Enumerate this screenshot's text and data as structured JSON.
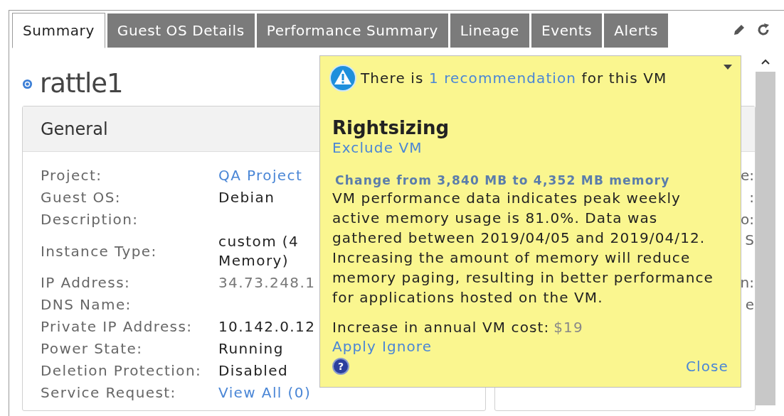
{
  "tabs": [
    {
      "label": "Summary",
      "selected": true
    },
    {
      "label": "Guest OS Details",
      "selected": false
    },
    {
      "label": "Performance Summary",
      "selected": false
    },
    {
      "label": "Lineage",
      "selected": false
    },
    {
      "label": "Events",
      "selected": false
    },
    {
      "label": "Alerts",
      "selected": false
    }
  ],
  "vm_name": "rattle1",
  "general": {
    "title": "General",
    "rows": [
      {
        "label": "Project:",
        "value": "QA Project",
        "kind": "link"
      },
      {
        "label": "Guest OS:",
        "value": "Debian",
        "kind": "text"
      },
      {
        "label": "Description:",
        "kind": "empty"
      },
      {
        "label": "Instance Type:",
        "value": "custom (4",
        "value_line_2": "Memory)",
        "kind": "text"
      },
      {
        "label": "IP Address:",
        "value": "34.73.248.1",
        "kind": "muted"
      },
      {
        "label": "DNS Name:",
        "kind": "empty"
      },
      {
        "label": "Private IP Address:",
        "value": "10.142.0.12",
        "kind": "text"
      },
      {
        "label": "Power State:",
        "value": "Running",
        "kind": "text"
      },
      {
        "label": "Deletion Protection:",
        "value": "Disabled",
        "kind": "text"
      },
      {
        "label": "Service Request:",
        "value": "View All (0)",
        "kind": "link"
      }
    ]
  },
  "side_card": {
    "fragments": [
      {
        "text": "e:",
        "kind": "single"
      },
      {
        "text": ":",
        "kind": "single"
      },
      {
        "text": "o:",
        "kind": "single"
      },
      {
        "text": "S",
        "kind": "wrapped"
      },
      {
        "text": "n:",
        "kind": "single"
      },
      {
        "text": "e",
        "kind": "single"
      }
    ]
  },
  "recommendation_popup": {
    "intro_before": "There is",
    "intro_link": "1 recommendation",
    "intro_after": "for this VM",
    "title": "Rightsizing",
    "exclude_link": "Exclude VM",
    "change": "Change from 3,840 MB to 4,352 MB memory",
    "description": "VM performance data indicates peak weekly active memory usage is 81.0%. Data was gathered between 2019/04/05 and 2019/04/12. Increasing the amount of memory will reduce memory paging, resulting in better performance for applications hosted on the VM.",
    "cost_label": "Increase in annual VM cost:",
    "cost_value": "$19",
    "actions": [
      "Apply",
      "Ignore"
    ],
    "help_glyph": "?",
    "close": "Close"
  }
}
